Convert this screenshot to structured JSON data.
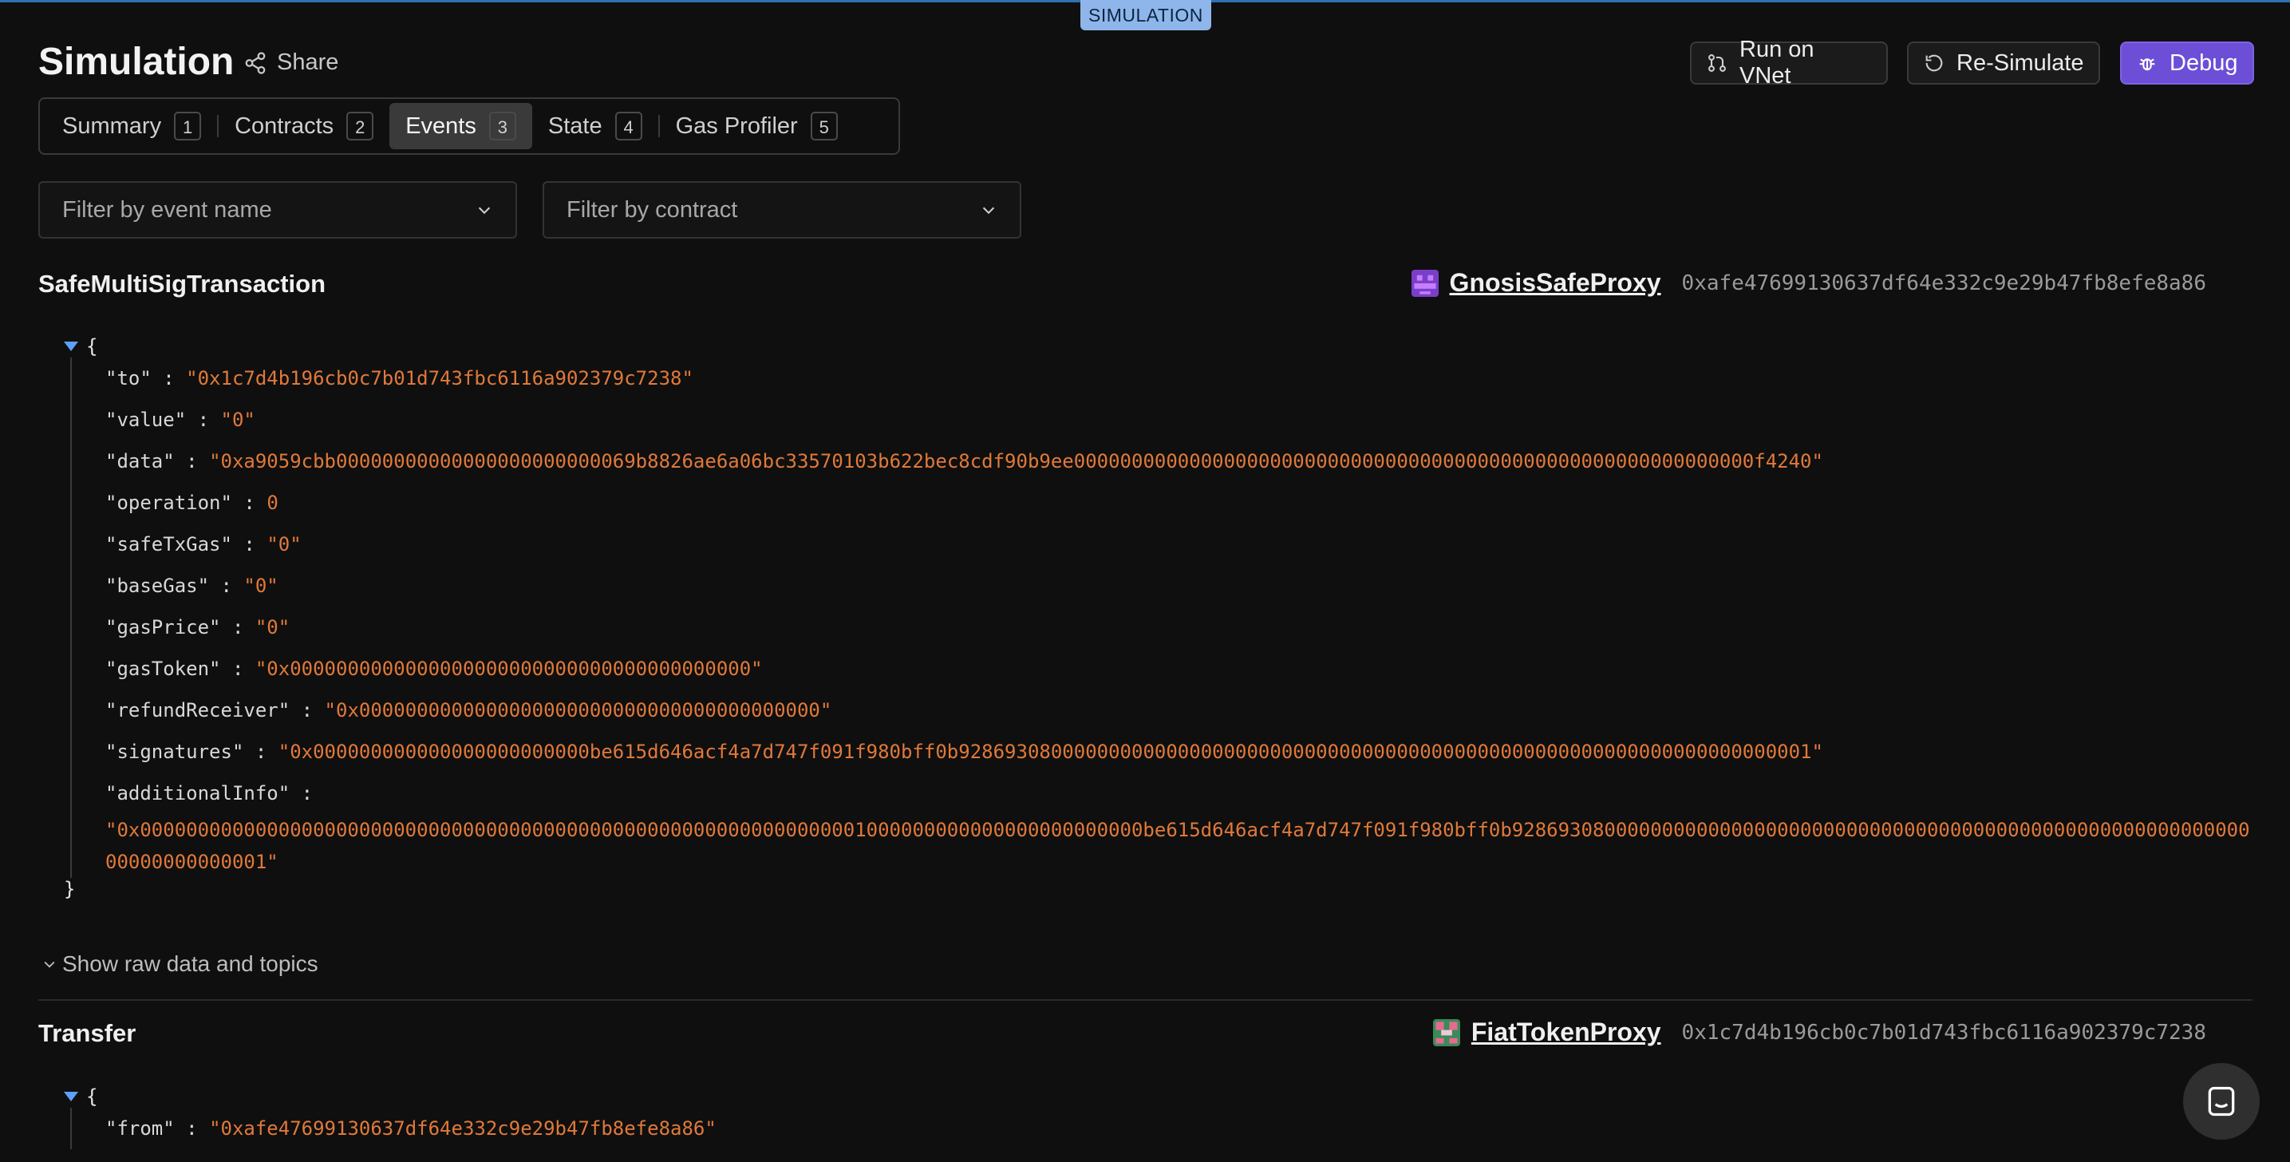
{
  "badge": "SIMULATION",
  "header": {
    "title": "Simulation",
    "share_label": "Share",
    "run_label": "Run on VNet",
    "resim_label": "Re-Simulate",
    "debug_label": "Debug"
  },
  "tabs": [
    {
      "label": "Summary",
      "num": "1"
    },
    {
      "label": "Contracts",
      "num": "2"
    },
    {
      "label": "Events",
      "num": "3"
    },
    {
      "label": "State",
      "num": "4"
    },
    {
      "label": "Gas Profiler",
      "num": "5"
    }
  ],
  "active_tab": "Events",
  "filters": {
    "event_placeholder": "Filter by event name",
    "contract_placeholder": "Filter by contract"
  },
  "events": [
    {
      "name": "SafeMultiSigTransaction",
      "contract_name": "GnosisSafeProxy",
      "contract_address": "0xafe47699130637df64e332c9e29b47fb8efe8a86",
      "open_brace": "{",
      "close_brace": "}",
      "fields": [
        {
          "key": "\"to\"",
          "value": "\"0x1c7d4b196cb0c7b01d743fbc6116a902379c7238\""
        },
        {
          "key": "\"value\"",
          "value": "\"0\""
        },
        {
          "key": "\"data\"",
          "value": "\"0xa9059cbb00000000000000000000000069b8826ae6a06bc33570103b622bec8cdf90b9ee00000000000000000000000000000000000000000000000000000000000f4240\""
        },
        {
          "key": "\"operation\"",
          "value": "0"
        },
        {
          "key": "\"safeTxGas\"",
          "value": "\"0\""
        },
        {
          "key": "\"baseGas\"",
          "value": "\"0\""
        },
        {
          "key": "\"gasPrice\"",
          "value": "\"0\""
        },
        {
          "key": "\"gasToken\"",
          "value": "\"0x0000000000000000000000000000000000000000\""
        },
        {
          "key": "\"refundReceiver\"",
          "value": "\"0x0000000000000000000000000000000000000000\""
        },
        {
          "key": "\"signatures\"",
          "value": "\"0x000000000000000000000000be615d646acf4a7d747f091f980bff0b92869308000000000000000000000000000000000000000000000000000000000000000001\""
        },
        {
          "key": "\"additionalInfo\"",
          "value": "\"0x000000000000000000000000000000000000000000000000000000000000001000000000000000000000000be615d646acf4a7d747f091f980bff0b928693080000000000000000000000000000000000000000000000000000000000000000000001\""
        }
      ],
      "raw_link": "Show raw data and topics"
    },
    {
      "name": "Transfer",
      "contract_name": "FiatTokenProxy",
      "contract_address": "0x1c7d4b196cb0c7b01d743fbc6116a902379c7238",
      "open_brace": "{",
      "fields": [
        {
          "key": "\"from\"",
          "value": "\"0xafe47699130637df64e332c9e29b47fb8efe8a86\""
        }
      ]
    }
  ],
  "colors": {
    "accent": "#6c4fd6",
    "string_value": "#e0793a",
    "badge_bg": "#8fb6ea"
  }
}
